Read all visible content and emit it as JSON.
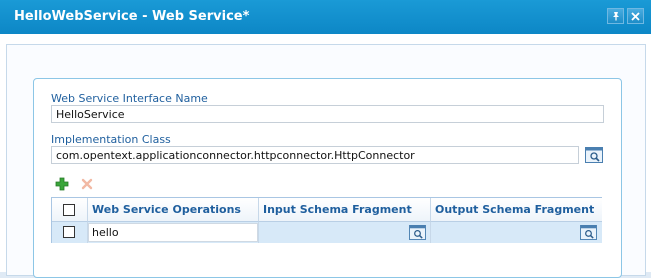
{
  "window": {
    "title": "HelloWebService - Web Service*"
  },
  "form": {
    "interface_name_label": "Web Service Interface Name",
    "interface_name_value": "HelloService",
    "impl_class_label": "Implementation Class",
    "impl_class_value": "com.opentext.applicationconnector.httpconnector.HttpConnector"
  },
  "toolbar": {
    "add_icon": "plus-icon",
    "delete_icon": "x-icon",
    "add_color": "#3aa53a",
    "delete_color": "#f2b9a4"
  },
  "grid": {
    "columns": [
      "Web Service Operations",
      "Input Schema Fragment",
      "Output Schema Fragment"
    ],
    "rows": [
      {
        "operation": "hello",
        "input": "",
        "output": ""
      }
    ]
  },
  "colors": {
    "titlebar": "#1592cf",
    "label": "#1f5f9e",
    "selected_row": "#d7e9f8"
  }
}
